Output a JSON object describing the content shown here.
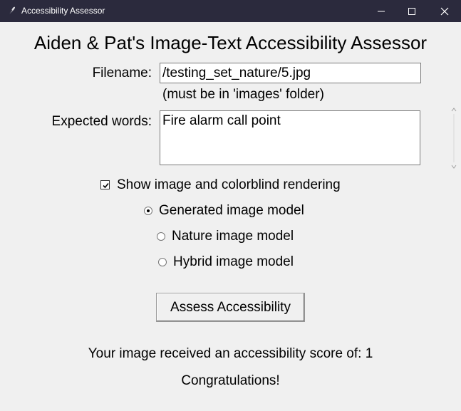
{
  "window": {
    "title": "Accessibility Assessor",
    "icon": "feather-icon",
    "controls": [
      "minimize-icon",
      "maximize-icon",
      "close-icon"
    ]
  },
  "app": {
    "heading": "Aiden & Pat's Image-Text Accessibility Assessor"
  },
  "form": {
    "filename_label": "Filename:",
    "filename_value": "/testing_set_nature/5.jpg",
    "filename_hint": "(must be in 'images' folder)",
    "expected_label": "Expected words:",
    "expected_value": "Fire alarm call point",
    "show_image_label": "Show image and colorblind rendering",
    "show_image_checked": true,
    "models": [
      {
        "label": "Generated image model",
        "selected": true
      },
      {
        "label": "Nature image model",
        "selected": false
      },
      {
        "label": "Hybrid image model",
        "selected": false
      }
    ],
    "assess_button": "Assess Accessibility"
  },
  "result": {
    "score_text": "Your image received an accessibility score of: 1",
    "message": "Congratulations!"
  },
  "colors": {
    "titlebar": "#2b2a3d",
    "background": "#f0f0f0"
  }
}
